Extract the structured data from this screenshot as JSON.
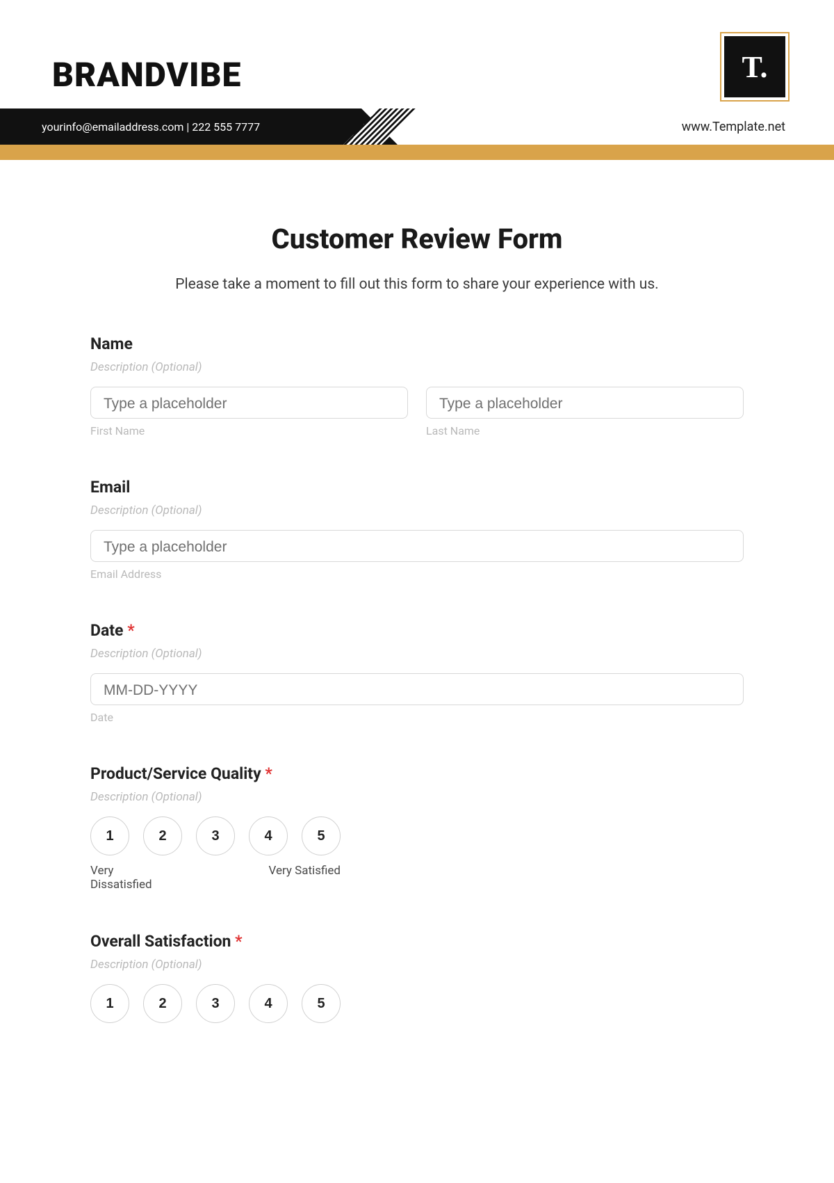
{
  "header": {
    "brand": "BRANDVIBE",
    "contact": "yourinfo@emailaddress.com  |  222 555 7777",
    "logo_text": "T.",
    "website": "www.Template.net"
  },
  "form": {
    "title": "Customer Review Form",
    "intro": "Please take a moment to fill out this form to share your experience with us."
  },
  "name": {
    "label": "Name",
    "desc": "Description (Optional)",
    "first_placeholder": "Type a placeholder",
    "first_sub": "First Name",
    "last_placeholder": "Type a placeholder",
    "last_sub": "Last Name"
  },
  "email": {
    "label": "Email",
    "desc": "Description (Optional)",
    "placeholder": "Type a placeholder",
    "sub": "Email Address"
  },
  "date": {
    "label": "Date ",
    "req": "*",
    "desc": "Description (Optional)",
    "placeholder": "MM-DD-YYYY",
    "sub": "Date"
  },
  "quality": {
    "label": "Product/Service Quality ",
    "req": "*",
    "desc": "Description (Optional)",
    "options": [
      "1",
      "2",
      "3",
      "4",
      "5"
    ],
    "low": "Very Dissatisfied",
    "high": "Very Satisfied"
  },
  "overall": {
    "label": "Overall Satisfaction ",
    "req": "*",
    "desc": "Description (Optional)",
    "options": [
      "1",
      "2",
      "3",
      "4",
      "5"
    ]
  }
}
